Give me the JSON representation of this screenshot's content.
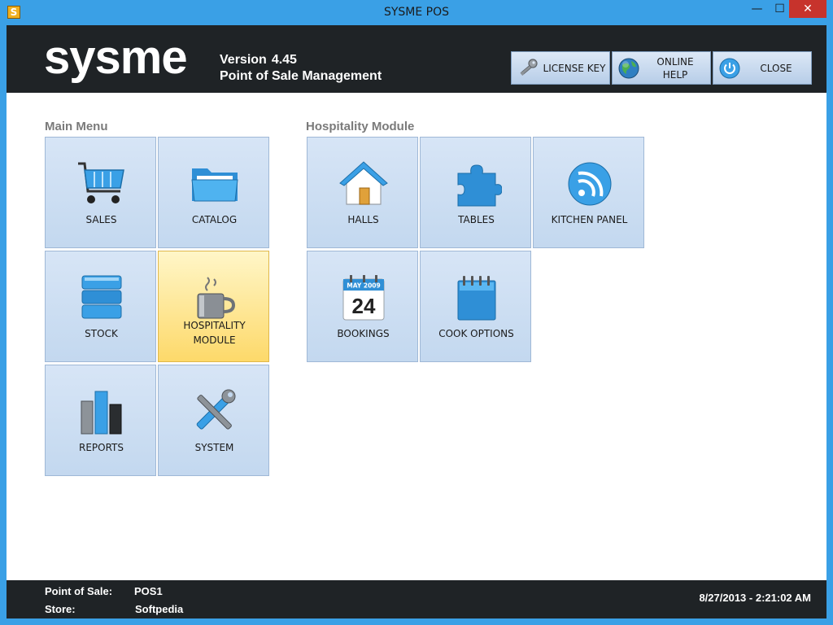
{
  "window": {
    "title": "SYSME POS",
    "icon_letter": "S",
    "controls": {
      "minimize": "—",
      "maximize": "☐",
      "close": "✕"
    }
  },
  "header": {
    "logo": "sysme",
    "version_label": "Version",
    "version_number": "4.45",
    "subtitle": "Point of Sale Management",
    "buttons": {
      "license": "LICENSE KEY",
      "help_line1": "ONLINE",
      "help_line2": "HELP",
      "close": "CLOSE"
    }
  },
  "main_menu": {
    "title": "Main Menu",
    "tiles": {
      "sales": "SALES",
      "catalog": "CATALOG",
      "stock": "STOCK",
      "hospitality_line1": "HOSPITALITY",
      "hospitality_line2": "MODULE",
      "reports": "REPORTS",
      "system": "SYSTEM"
    }
  },
  "hospitality": {
    "title": "Hospitality Module",
    "tiles": {
      "halls": "HALLS",
      "tables": "TABLES",
      "kitchen_panel": "KITCHEN PANEL",
      "bookings": "BOOKINGS",
      "bookings_month": "MAY 2009",
      "bookings_day": "24",
      "cook_options": "COOK OPTIONS"
    }
  },
  "footer": {
    "pos_label": "Point of Sale:",
    "pos_value": "POS1",
    "store_label": "Store:",
    "store_value": "Softpedia",
    "datetime": "8/27/2013 - 2:21:02 AM"
  },
  "colors": {
    "accent": "#3aa0e6",
    "header_bg": "#1f2326",
    "tile_bg": "#c3d8ef",
    "tile_active": "#fdd96a"
  }
}
